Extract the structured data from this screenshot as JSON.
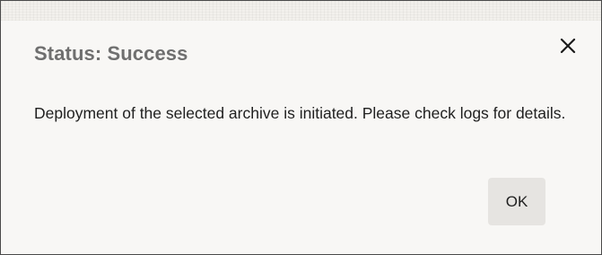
{
  "dialog": {
    "title": "Status: Success",
    "message": "Deployment of the selected archive is initiated. Please check logs for details.",
    "close_icon": "close-icon",
    "ok_label": "OK"
  }
}
